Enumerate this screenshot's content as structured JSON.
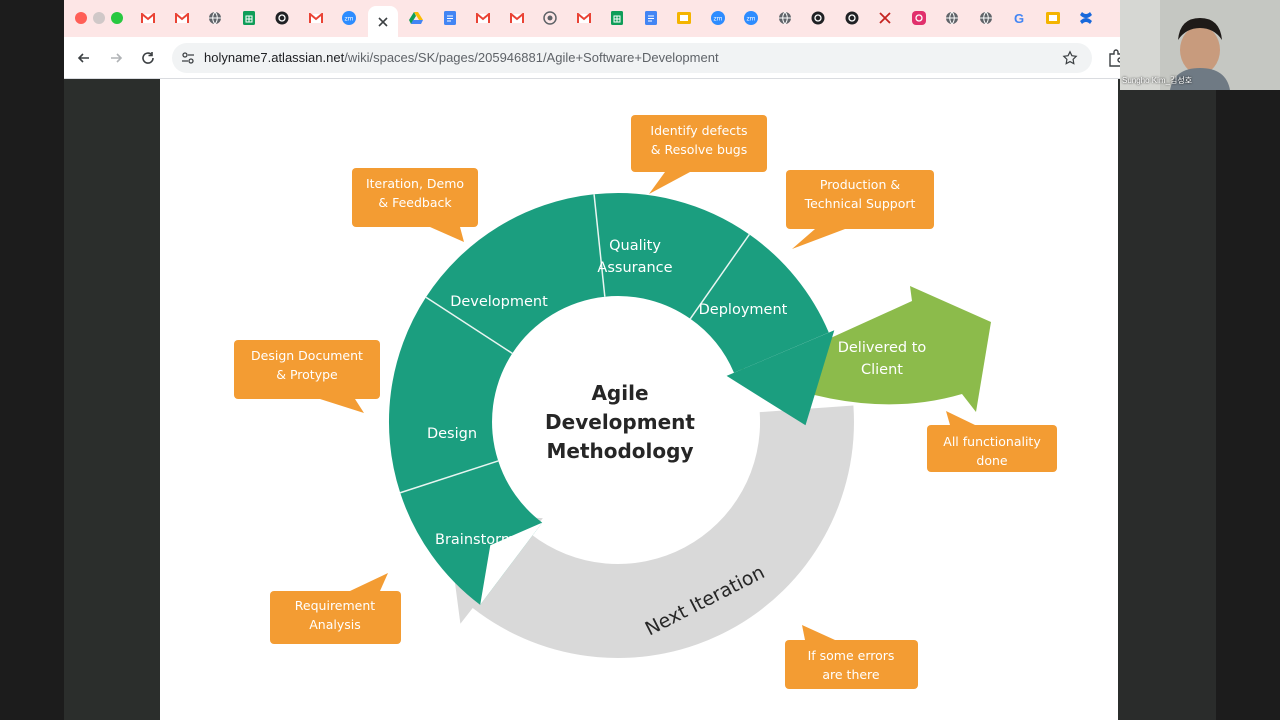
{
  "browser": {
    "url_host": "holyname7.atlassian.net",
    "url_path": "/wiki/spaces/SK/pages/205946881/Agile+Software+Development",
    "tabs": [
      {
        "icon": "gmail-icon"
      },
      {
        "icon": "gmail-icon"
      },
      {
        "icon": "globe-icon"
      },
      {
        "icon": "sheets-icon"
      },
      {
        "icon": "openai-icon"
      },
      {
        "icon": "gmail-icon"
      },
      {
        "icon": "zoom-icon"
      },
      {
        "icon": "close-icon",
        "active": true
      },
      {
        "icon": "drive-icon"
      },
      {
        "icon": "docs-icon"
      },
      {
        "icon": "gmail-icon"
      },
      {
        "icon": "gmail-icon"
      },
      {
        "icon": "chrome-icon"
      },
      {
        "icon": "gmail-icon"
      },
      {
        "icon": "sheets-icon"
      },
      {
        "icon": "docs-icon"
      },
      {
        "icon": "slides-icon"
      },
      {
        "icon": "zoom-icon"
      },
      {
        "icon": "zoom-icon"
      },
      {
        "icon": "globe-icon"
      },
      {
        "icon": "openai-icon"
      },
      {
        "icon": "openai-icon"
      },
      {
        "icon": "x-icon"
      },
      {
        "icon": "instagram-icon"
      },
      {
        "icon": "globe-icon"
      },
      {
        "icon": "globe-icon"
      },
      {
        "icon": "google-icon"
      },
      {
        "icon": "slides-icon"
      },
      {
        "icon": "confluence-icon"
      }
    ],
    "colors": {
      "tabstrip": "#fde6e6",
      "toolbar": "#ffffff",
      "omnibox": "#f1f3f4"
    }
  },
  "diagram": {
    "center_lines": [
      "Agile",
      "Development",
      "Methodology"
    ],
    "segments": [
      {
        "label": "Brainstorm"
      },
      {
        "label": "Design"
      },
      {
        "label": "Development"
      },
      {
        "label_lines": [
          "Quality",
          "Assurance"
        ]
      },
      {
        "label": "Deployment"
      }
    ],
    "delivered_lines": [
      "Delivered to",
      "Client"
    ],
    "next_iteration": "Next Iteration",
    "callouts": [
      {
        "lines": [
          "Identify defects",
          "& Resolve bugs"
        ]
      },
      {
        "lines": [
          "Iteration, Demo",
          "& Feedback"
        ]
      },
      {
        "lines": [
          "Production &",
          "Technical Support"
        ]
      },
      {
        "lines": [
          "Design Document",
          "& Protype"
        ]
      },
      {
        "lines": [
          "All functionality",
          "done"
        ]
      },
      {
        "lines": [
          "Requirement",
          "Analysis"
        ]
      },
      {
        "lines": [
          "If some errors",
          "are there"
        ]
      }
    ],
    "colors": {
      "teal": "#1b9e7f",
      "green": "#8cbb4b",
      "gray": "#d9d9d9",
      "orange": "#f39c33"
    }
  },
  "video": {
    "participant_name": "Sungho Kim_김성호"
  }
}
